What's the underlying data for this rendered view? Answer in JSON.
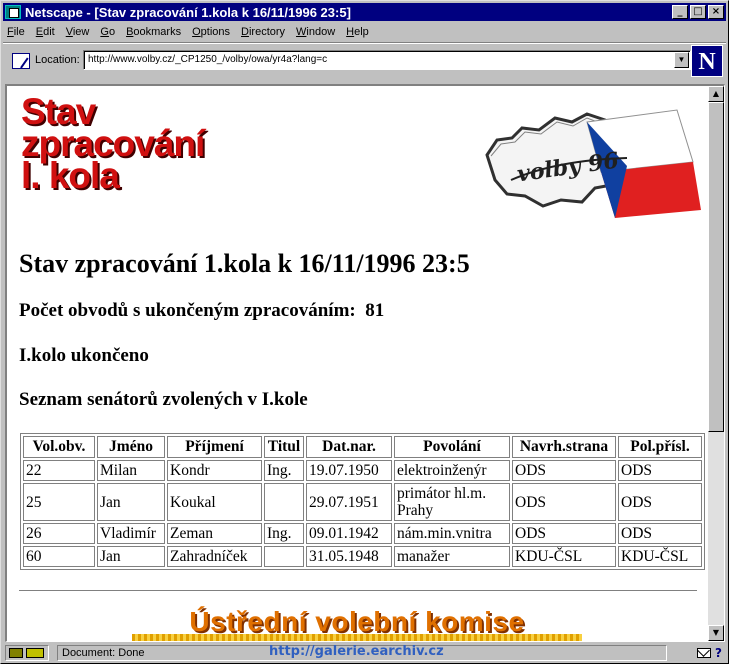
{
  "window": {
    "title": "Netscape - [Stav zpracování 1.kola k 16/11/1996 23:5]",
    "buttons": {
      "minimize": "_",
      "maximize": "□",
      "close": "×"
    }
  },
  "menu": [
    {
      "accel": "F",
      "rest": "ile"
    },
    {
      "accel": "E",
      "rest": "dit"
    },
    {
      "accel": "V",
      "rest": "iew"
    },
    {
      "accel": "G",
      "rest": "o"
    },
    {
      "accel": "B",
      "rest": "ookmarks"
    },
    {
      "accel": "O",
      "rest": "ptions"
    },
    {
      "accel": "D",
      "rest": "irectory"
    },
    {
      "accel": "W",
      "rest": "indow"
    },
    {
      "accel": "H",
      "rest": "elp"
    }
  ],
  "location": {
    "label": "Location:",
    "url": "http://www.volby.cz/_CP1250_/volby/owa/yr4a?lang=c"
  },
  "brand": {
    "logo_letter": "N"
  },
  "page": {
    "logo_lines": [
      "Stav",
      "zpracování",
      "l. kola"
    ],
    "volby_logo_text": "volby 96",
    "heading": "Stav zpracování 1.kola k 16/11/1996 23:5",
    "obvody_label": "Počet obvodů s ukončeným zpracováním:",
    "obvody_value": "81",
    "status_line": "I.kolo ukončeno",
    "list_title": "Seznam senátorů zvolených v I.kole",
    "table": {
      "headers": [
        "Vol.obv.",
        "Jméno",
        "Příjmení",
        "Titul",
        "Dat.nar.",
        "Povolání",
        "Navrh.strana",
        "Pol.přísl."
      ],
      "rows": [
        [
          "22",
          "Milan",
          "Kondr",
          "Ing.",
          "19.07.1950",
          "elektroinženýr",
          "ODS",
          "ODS"
        ],
        [
          "25",
          "Jan",
          "Koukal",
          "",
          "29.07.1951",
          "primátor hl.m. Prahy",
          "ODS",
          "ODS"
        ],
        [
          "26",
          "Vladimír",
          "Zeman",
          "Ing.",
          "09.01.1942",
          "nám.min.vnitra",
          "ODS",
          "ODS"
        ],
        [
          "60",
          "Jan",
          "Zahradníček",
          "",
          "31.05.1948",
          "manažer",
          "KDU-ČSL",
          "KDU-ČSL"
        ]
      ]
    },
    "footer_banner": "Ústřední volební komise"
  },
  "statusbar": {
    "text": "Document: Done",
    "watermark": "http://galerie.earchiv.cz"
  },
  "colors": {
    "titlebar": "#000080",
    "logo_red": "#d01010",
    "banner_orange": "#e07000",
    "flag_white": "#ffffff",
    "flag_blue": "#1040a0",
    "flag_red": "#e02020"
  }
}
